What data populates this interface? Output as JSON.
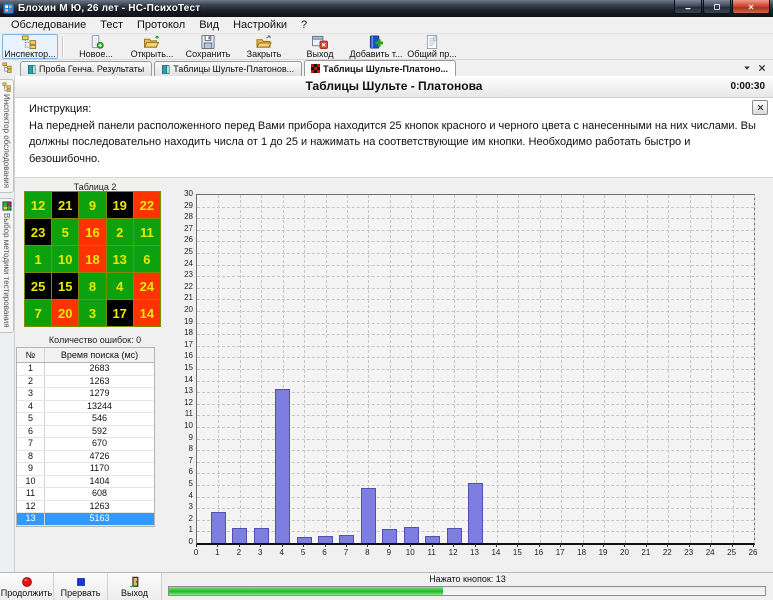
{
  "window": {
    "title": "Блохин М Ю, 26 лет  - НС-ПсихоТест",
    "controls": [
      {
        "name": "minimize-button",
        "icon": "minimize-icon"
      },
      {
        "name": "maximize-button",
        "icon": "maximize-icon"
      },
      {
        "name": "close-button",
        "icon": "close-icon"
      }
    ]
  },
  "menu": {
    "items": [
      "Обследование",
      "Тест",
      "Протокол",
      "Вид",
      "Настройки",
      "?"
    ]
  },
  "toolbar": {
    "buttons": [
      {
        "label": "Инспектор...",
        "icon": "inspector-tree-icon",
        "selected": true
      },
      {
        "label": "Новое...",
        "icon": "new-session-icon",
        "selected": false
      },
      {
        "label": "Открыть...",
        "icon": "open-folder-icon",
        "selected": false
      },
      {
        "label": "Сохранить",
        "icon": "save-floppy-icon",
        "selected": false
      },
      {
        "label": "Закрыть",
        "icon": "close-folder-icon",
        "selected": false
      },
      {
        "label": "Выход",
        "icon": "exit-window-icon",
        "selected": false
      },
      {
        "label": "Добавить т...",
        "icon": "add-test-icon",
        "selected": false
      },
      {
        "label": "Общий пр...",
        "icon": "report-document-icon",
        "selected": false
      }
    ]
  },
  "tabbar": {
    "tabs": [
      {
        "label": "Проба Генча. Результаты",
        "icon": "book-icon",
        "active": false
      },
      {
        "label": "Таблицы Шульте-Платонов...",
        "icon": "book-icon",
        "active": false
      },
      {
        "label": "Таблицы Шульте-Платоно...",
        "icon": "checkerboard-icon",
        "active": true
      }
    ]
  },
  "sidebar": {
    "tabs": [
      {
        "label": "Инспектор обследования",
        "icon": "tree-small-icon"
      },
      {
        "label": "Выбор методики тестирования",
        "icon": "methods-icon"
      }
    ]
  },
  "test": {
    "title": "Таблицы Шульте - Платонова",
    "timer": "0:00:30",
    "instruction_label": "Инструкция:",
    "instruction_text": "На передней панели расположенного перед Вами прибора находится 25 кнопок красного и черного цвета с нанесенными на них числами. Вы должны последовательно находить числа от 1 до 25 и нажимать на соответствующие им кнопки. Необходимо работать быстро и безошибочно.",
    "table_label": "Таблица 2",
    "grid": [
      [
        {
          "n": 12,
          "c": "green"
        },
        {
          "n": 21,
          "c": "black"
        },
        {
          "n": 9,
          "c": "green"
        },
        {
          "n": 19,
          "c": "black"
        },
        {
          "n": 22,
          "c": "red"
        }
      ],
      [
        {
          "n": 23,
          "c": "black"
        },
        {
          "n": 5,
          "c": "green"
        },
        {
          "n": 16,
          "c": "red"
        },
        {
          "n": 2,
          "c": "green"
        },
        {
          "n": 11,
          "c": "green"
        }
      ],
      [
        {
          "n": 1,
          "c": "green"
        },
        {
          "n": 10,
          "c": "green"
        },
        {
          "n": 18,
          "c": "red"
        },
        {
          "n": 13,
          "c": "green"
        },
        {
          "n": 6,
          "c": "green"
        }
      ],
      [
        {
          "n": 25,
          "c": "black"
        },
        {
          "n": 15,
          "c": "black"
        },
        {
          "n": 8,
          "c": "green"
        },
        {
          "n": 4,
          "c": "green"
        },
        {
          "n": 24,
          "c": "red"
        }
      ],
      [
        {
          "n": 7,
          "c": "green"
        },
        {
          "n": 20,
          "c": "red"
        },
        {
          "n": 3,
          "c": "green"
        },
        {
          "n": 17,
          "c": "black"
        },
        {
          "n": 14,
          "c": "red"
        }
      ]
    ],
    "errors_label": "Количество ошибок: 0",
    "results": {
      "headers": [
        "№",
        "Время поиска (мс)"
      ],
      "rows": [
        [
          1,
          2683
        ],
        [
          2,
          1263
        ],
        [
          3,
          1279
        ],
        [
          4,
          13244
        ],
        [
          5,
          546
        ],
        [
          6,
          592
        ],
        [
          7,
          670
        ],
        [
          8,
          4726
        ],
        [
          9,
          1170
        ],
        [
          10,
          1404
        ],
        [
          11,
          608
        ],
        [
          12,
          1263
        ],
        [
          13,
          5163
        ]
      ],
      "selected_number": 13
    }
  },
  "chart_data": {
    "type": "bar",
    "x": [
      1,
      2,
      3,
      4,
      5,
      6,
      7,
      8,
      9,
      10,
      11,
      12,
      13
    ],
    "values": [
      2.683,
      1.263,
      1.279,
      13.244,
      0.546,
      0.592,
      0.67,
      4.726,
      1.17,
      1.404,
      0.608,
      1.263,
      5.163
    ],
    "title": "",
    "xlabel": "",
    "ylabel": "",
    "xlim": [
      0,
      26
    ],
    "ylim": [
      0,
      30
    ],
    "x_tick_step": 1,
    "y_tick_step": 1,
    "grid": true,
    "legend": "none",
    "bar_color": "#7e7ee0",
    "bar_border": "#5252ae"
  },
  "bottom": {
    "buttons": [
      {
        "label": "Продолжить",
        "icon": "continue-circle-icon"
      },
      {
        "label": "Прервать",
        "icon": "break-square-icon"
      },
      {
        "label": "Выход",
        "icon": "exit-door-icon"
      }
    ],
    "status": "Нажато кнопок: 13",
    "progress_percent": 46
  },
  "colors": {
    "cell_green": "#0da10d",
    "cell_red": "#ff3300",
    "cell_black": "#000000",
    "cell_number": "#e9e900",
    "cell_border": "#7f8b00",
    "selected_row_bg": "#3399ff",
    "selected_row_text": "#ffffff"
  }
}
